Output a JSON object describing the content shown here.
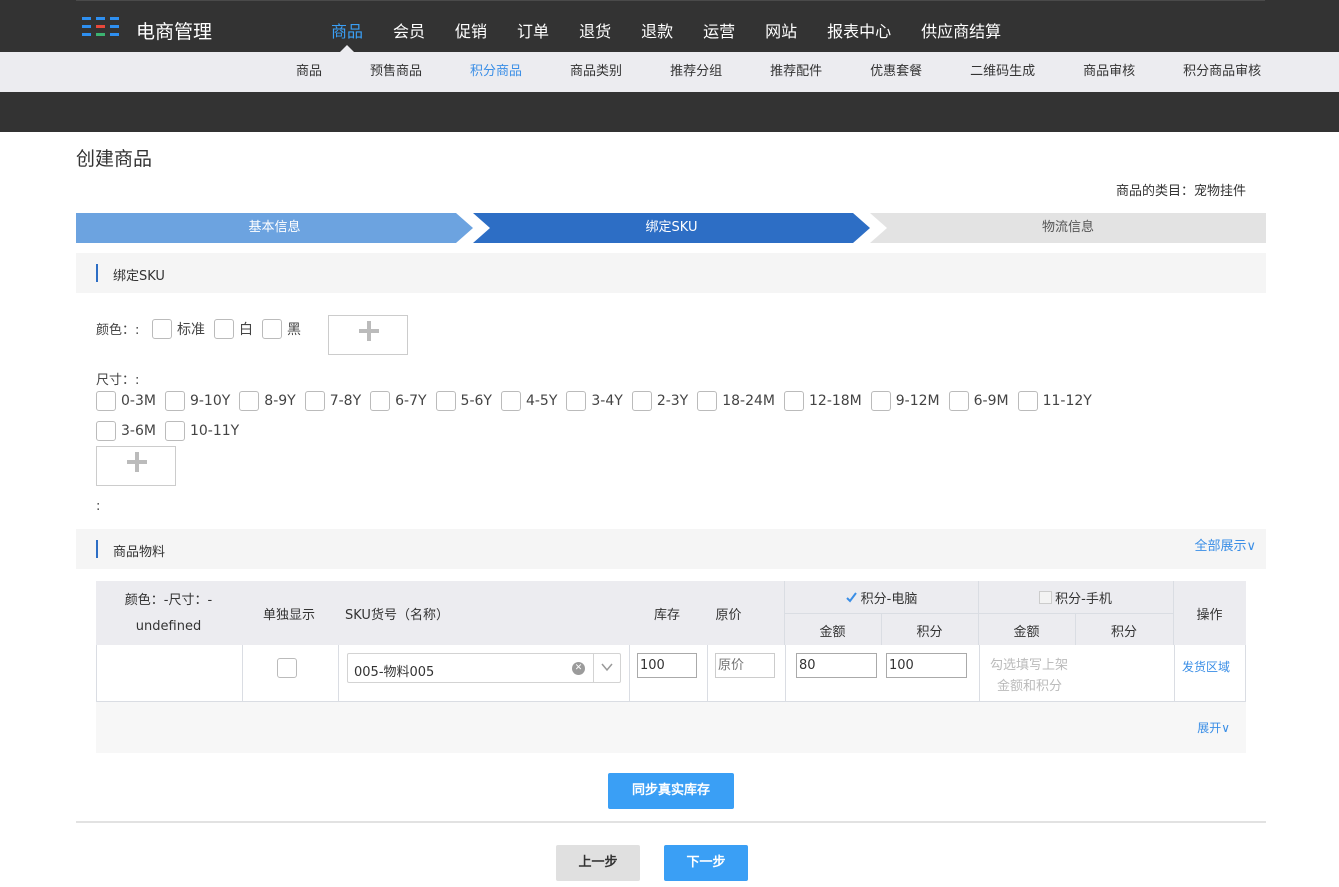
{
  "brand": {
    "name": "电商管理"
  },
  "main_nav": [
    "商品",
    "会员",
    "促销",
    "订单",
    "退货",
    "退款",
    "运营",
    "网站",
    "报表中心",
    "供应商结算"
  ],
  "main_nav_active": "商品",
  "sub_nav": [
    "商品",
    "预售商品",
    "积分商品",
    "商品类别",
    "推荐分组",
    "推荐配件",
    "优惠套餐",
    "二维码生成",
    "商品审核",
    "积分商品审核"
  ],
  "sub_nav_active": "积分商品",
  "page": {
    "title": "创建商品",
    "category": "商品的类目：宠物挂件"
  },
  "steps": [
    "基本信息",
    "绑定SKU",
    "物流信息"
  ],
  "bind_sku": {
    "section_title": "绑定SKU",
    "color_label": "颜色：:",
    "colors": [
      "标准",
      "白",
      "黑"
    ],
    "size_label": "尺寸：:",
    "sizes": [
      "0-3M",
      "9-10Y",
      "8-9Y",
      "7-8Y",
      "6-7Y",
      "5-6Y",
      "4-5Y",
      "3-4Y",
      "2-3Y",
      "18-24M",
      "12-18M",
      "9-12M",
      "6-9M",
      "11-12Y",
      "3-6M",
      "10-11Y"
    ],
    "trailing_label": ":"
  },
  "materials": {
    "section_title": "商品物料",
    "expand_all": "全部展示∨",
    "headers": {
      "spec_line1": "颜色：-尺寸：-",
      "spec_line2": "undefined",
      "single_display": "单独显示",
      "sku": "SKU货号（名称）",
      "stock": "库存",
      "original_price": "原价",
      "pc_group": "积分-电脑",
      "mobile_group": "积分-手机",
      "amount": "金额",
      "points": "积分",
      "actions": "操作"
    },
    "row": {
      "sku_value": "005-物料005",
      "stock": "100",
      "original_price_placeholder": "原价",
      "pc_amount": "80",
      "pc_points": "100",
      "mobile_hint_line1": "勾选填写上架",
      "mobile_hint_line2": "金额和积分",
      "action": "发货区域"
    },
    "expand": "展开∨"
  },
  "buttons": {
    "sync_stock": "同步真实库存",
    "prev": "上一步",
    "next": "下一步"
  },
  "colors": {
    "accent": "#3a9ff5",
    "nav_bg": "#333333",
    "step_done": "#6ca3e0",
    "step_active": "#2d6ec5"
  }
}
